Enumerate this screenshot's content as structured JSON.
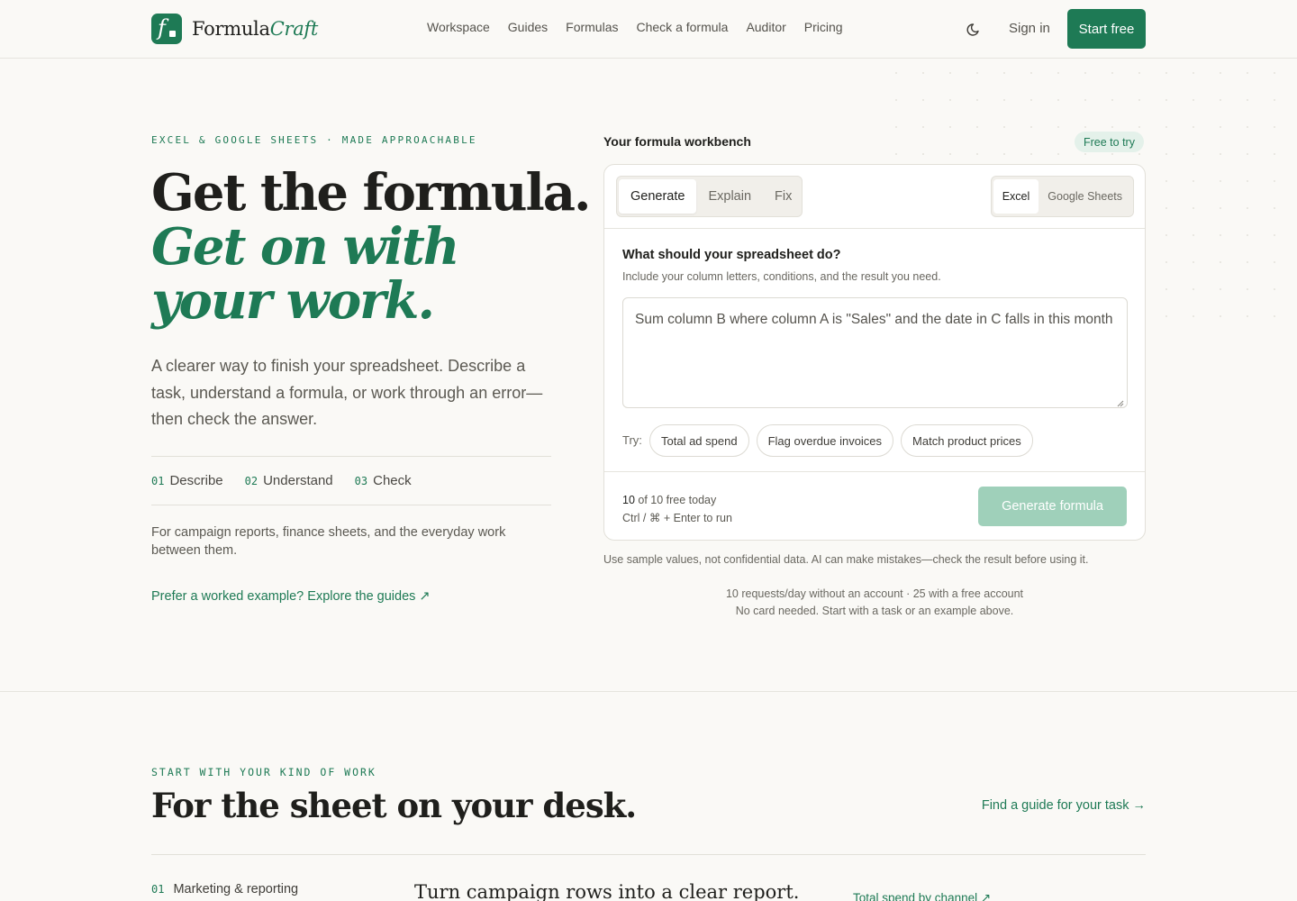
{
  "header": {
    "logo_part1": "Formula",
    "logo_part2": "Craft",
    "nav": [
      "Workspace",
      "Guides",
      "Formulas",
      "Check a formula",
      "Auditor",
      "Pricing"
    ],
    "sign_in": "Sign in",
    "start_free": "Start free"
  },
  "hero": {
    "eyebrow": "EXCEL & GOOGLE SHEETS · MADE APPROACHABLE",
    "title_line1": "Get the formula.",
    "title_line2": "Get on with",
    "title_line3": "your work.",
    "lead": "A clearer way to finish your spreadsheet. Describe a task, understand a formula, or work through an error—then check the answer.",
    "steps": [
      {
        "num": "01",
        "label": "Describe"
      },
      {
        "num": "02",
        "label": "Understand"
      },
      {
        "num": "03",
        "label": "Check"
      }
    ],
    "for_line": "For campaign reports, finance sheets, and the everyday work between them.",
    "guides_link": "Prefer a worked example? Explore the guides ↗"
  },
  "workbench": {
    "title": "Your formula workbench",
    "badge": "Free to try",
    "modes": [
      "Generate",
      "Explain",
      "Fix"
    ],
    "apps": [
      "Excel",
      "Google Sheets"
    ],
    "question": "What should your spreadsheet do?",
    "hint": "Include your column letters, conditions, and the result you need.",
    "textarea_value": "Sum column B where column A is \"Sales\" and the date in C falls in this month",
    "try_label": "Try:",
    "chips": [
      "Total ad spend",
      "Flag overdue invoices",
      "Match product prices"
    ],
    "quota_count": "10",
    "quota_text": "of 10 free today",
    "shortcut": "Ctrl / ⌘ + Enter to run",
    "generate_button": "Generate formula",
    "disclaimer": "Use sample values, not confidential data. AI can make mistakes—check the result before using it.",
    "limits_line1": "10 requests/day without an account · 25 with a free account",
    "limits_line2": "No card needed. Start with a task or an example above."
  },
  "section2": {
    "eyebrow": "START WITH YOUR KIND OF WORK",
    "title": "For the sheet on your desk.",
    "find_link": "Find a guide for your task →",
    "category_num": "01",
    "category_label": "Marketing & reporting",
    "category_title": "Turn campaign rows into a clear report.",
    "category_link": "Total spend by channel ↗"
  },
  "colors": {
    "accent": "#1e7a55",
    "background": "#faf9f6",
    "button_disabled": "#9fd0ba"
  },
  "icons": {
    "theme_toggle": "moon-icon",
    "logo": "formula-f-icon"
  }
}
